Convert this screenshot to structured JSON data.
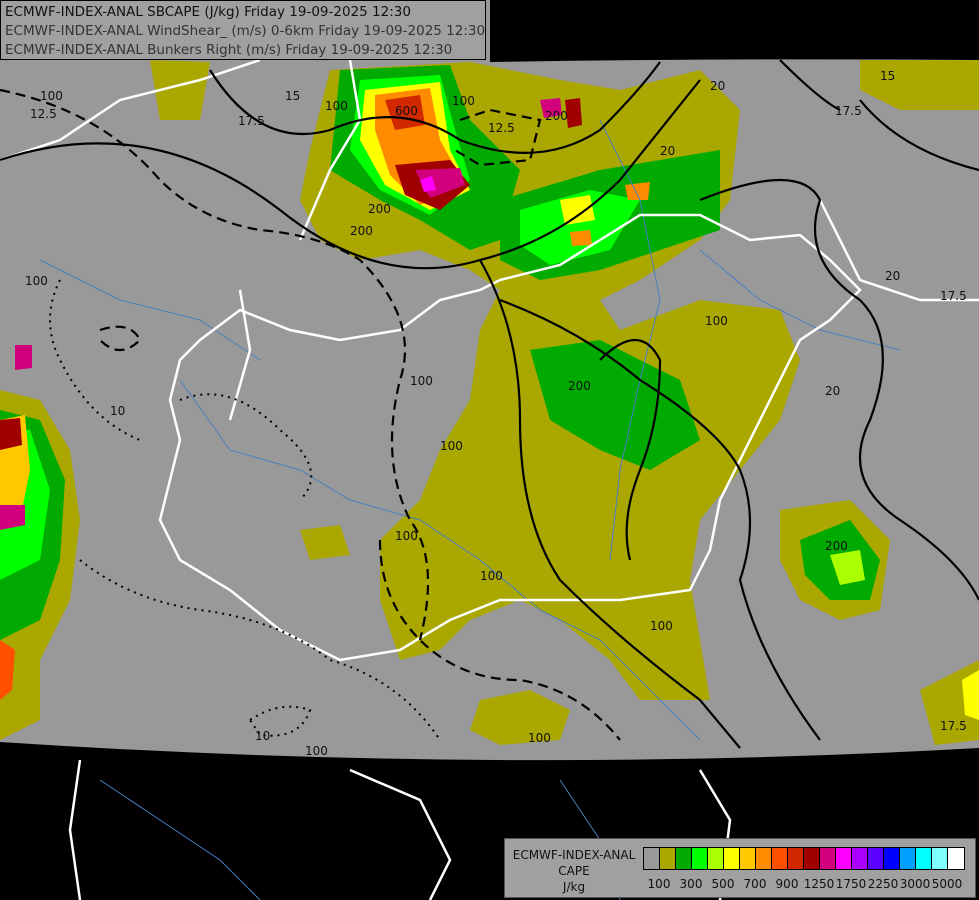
{
  "header": {
    "line1": "ECMWF-INDEX-ANAL SBCAPE (J/kg) Friday 19-09-2025 12:30",
    "line2": "ECMWF-INDEX-ANAL WindShear_ (m/s) 0-6km Friday 19-09-2025 12:30",
    "line3": "ECMWF-INDEX-ANAL Bunkers Right (m/s) Friday 19-09-2025 12:30"
  },
  "legend": {
    "title_line1": "ECMWF-INDEX-ANAL",
    "title_line2": "CAPE",
    "unit": "J/kg",
    "colors": [
      "#999999",
      "#aaa700",
      "#00aa00",
      "#00ff00",
      "#aaff00",
      "#ffff00",
      "#ffc800",
      "#ff8c00",
      "#ff5000",
      "#d22800",
      "#a00000",
      "#d2007d",
      "#ff00ff",
      "#aa00ff",
      "#5a00ff",
      "#0000ff",
      "#00a0ff",
      "#00ffff",
      "#80ffff",
      "#ffffff"
    ],
    "tick_labels": [
      "100",
      "300",
      "500",
      "700",
      "900",
      "1250",
      "1750",
      "2250",
      "3000",
      "5000"
    ]
  },
  "map": {
    "background": "#999999",
    "outside": "#000000",
    "border_color": "#ffffff",
    "river_color": "#4a7fc0",
    "contour_labels": [
      "12.5",
      "15",
      "17.5",
      "20",
      "15",
      "12.5",
      "17.5",
      "20",
      "20",
      "17.5",
      "10",
      "10",
      "100",
      "100",
      "200",
      "200",
      "600",
      "100",
      "200",
      "100",
      "200",
      "100",
      "100",
      "100",
      "100",
      "200",
      "100",
      "100",
      "20",
      "17.5",
      "100",
      "100"
    ]
  }
}
